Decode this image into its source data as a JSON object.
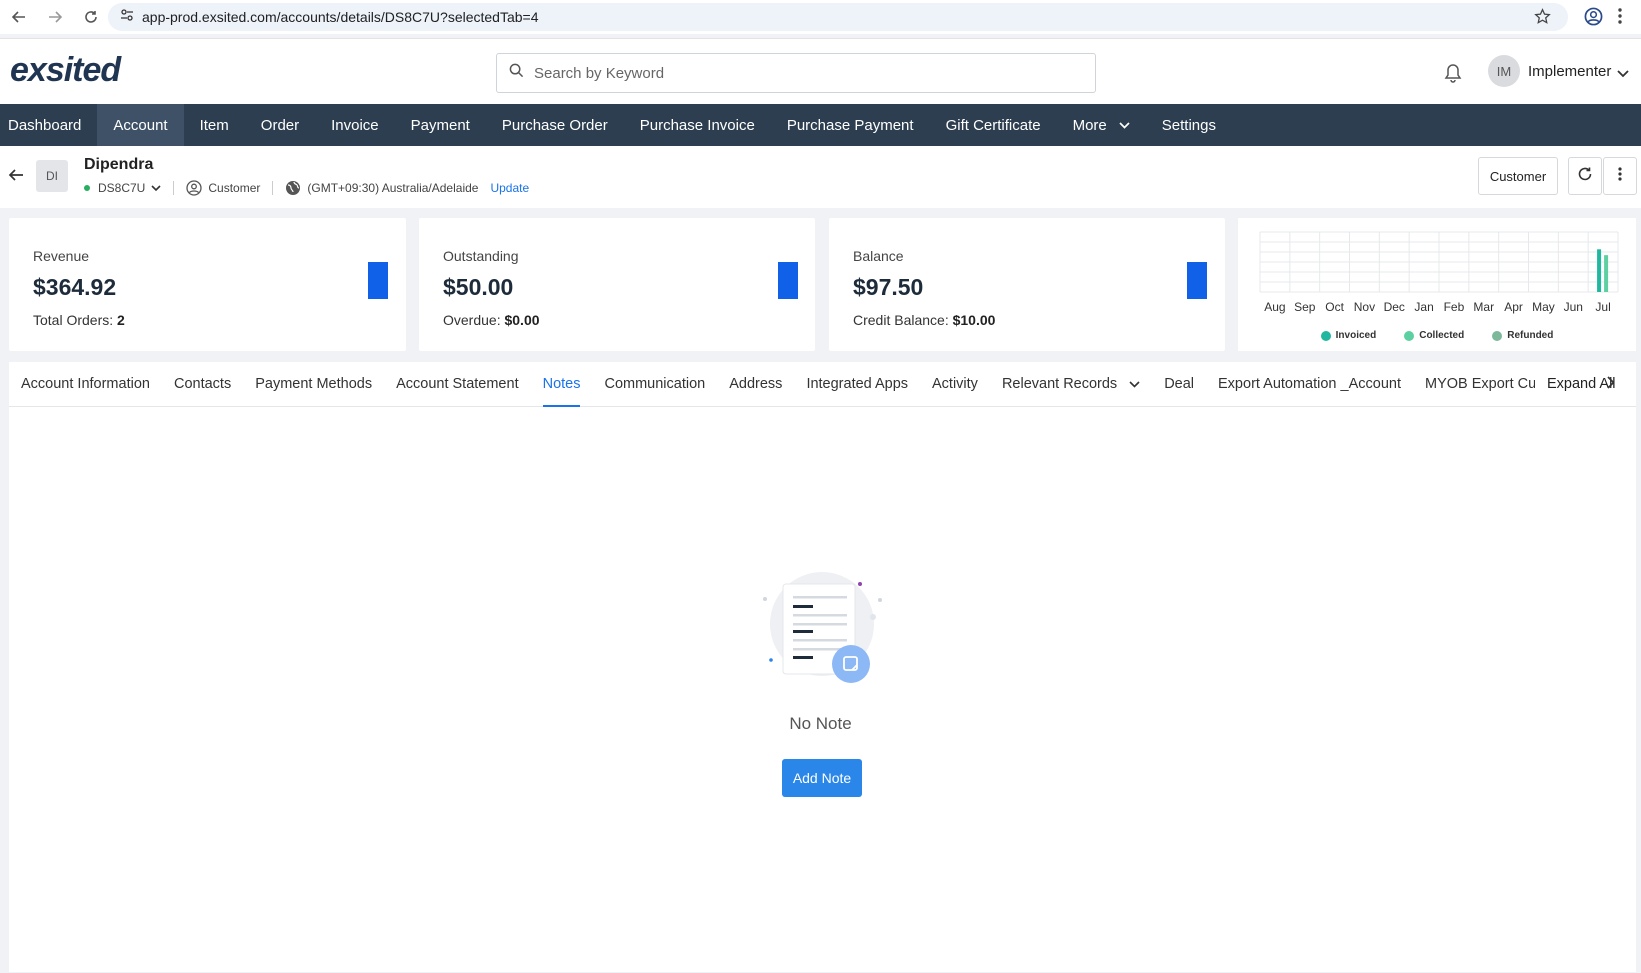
{
  "browser": {
    "url": "app-prod.exsited.com/accounts/details/DS8C7U?selectedTab=4"
  },
  "header": {
    "logo_text": "exsited",
    "search_placeholder": "Search by Keyword",
    "user_initials": "IM",
    "user_name": "Implementer"
  },
  "nav": {
    "items": [
      "Dashboard",
      "Account",
      "Item",
      "Order",
      "Invoice",
      "Payment",
      "Purchase Order",
      "Purchase Invoice",
      "Purchase Payment",
      "Gift Certificate",
      "More",
      "Settings"
    ],
    "active": "Account"
  },
  "account": {
    "initials": "DI",
    "name": "Dipendra",
    "id": "DS8C7U",
    "type": "Customer",
    "timezone": "(GMT+09:30) Australia/Adelaide",
    "update_label": "Update",
    "customer_button": "Customer"
  },
  "cards": {
    "revenue": {
      "label": "Revenue",
      "value": "$364.92",
      "sub_label": "Total Orders: ",
      "sub_value": "2"
    },
    "outstanding": {
      "label": "Outstanding",
      "value": "$50.00",
      "sub_label": "Overdue: ",
      "sub_value": "$0.00"
    },
    "balance": {
      "label": "Balance",
      "value": "$97.50",
      "sub_label": "Credit Balance: ",
      "sub_value": "$10.00"
    }
  },
  "colors": {
    "nav_bg": "#2c3e50",
    "accent": "#1a73e8",
    "card_bar": "#1060e8",
    "invoiced": "#1fb7a0",
    "collected": "#5cd0a0",
    "refunded": "#7db89a"
  },
  "chart_data": {
    "type": "bar",
    "categories": [
      "Aug",
      "Sep",
      "Oct",
      "Nov",
      "Dec",
      "Jan",
      "Feb",
      "Mar",
      "Apr",
      "May",
      "Jun",
      "Jul"
    ],
    "series": [
      {
        "name": "Invoiced",
        "values": [
          0,
          0,
          0,
          0,
          0,
          0,
          0,
          0,
          0,
          0,
          0,
          364.92
        ]
      },
      {
        "name": "Collected",
        "values": [
          0,
          0,
          0,
          0,
          0,
          0,
          0,
          0,
          0,
          0,
          0,
          314.92
        ]
      },
      {
        "name": "Refunded",
        "values": [
          0,
          0,
          0,
          0,
          0,
          0,
          0,
          0,
          0,
          0,
          0,
          0
        ]
      }
    ],
    "ylim": [
      0,
      400
    ],
    "grid": true,
    "legend_position": "bottom"
  },
  "tabs": {
    "items": [
      "Account Information",
      "Contacts",
      "Payment Methods",
      "Account Statement",
      "Notes",
      "Communication",
      "Address",
      "Integrated Apps",
      "Activity",
      "Relevant Records",
      "Deal",
      "Export Automation _Account",
      "MYOB Export Cus"
    ],
    "active": "Notes",
    "expand_all": "Expand All"
  },
  "empty_state": {
    "title": "No Note",
    "button": "Add Note"
  }
}
